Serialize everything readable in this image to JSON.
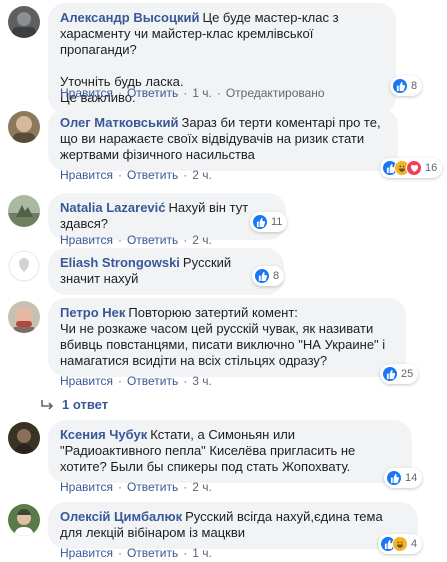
{
  "action_labels": {
    "like": "Нравится",
    "reply": "Ответить",
    "edited": "Отредактировано"
  },
  "comments": [
    {
      "author": "Александр Высоцкий",
      "text": "Це буде мастер-клас з харасменту чи майстер-клас кремлівської пропаганди?\n\nУточніть будь ласка.\nЦе важливо.",
      "time": "1 ч.",
      "reaction_count": "8",
      "edited": true
    },
    {
      "author": "Олег Матковський",
      "text": "Зараз би терти коментарі про те, що ви наражаєте своїх відвідувачів на ризик стати жертвами фізичного насильства",
      "time": "2 ч.",
      "reaction_count": "16"
    },
    {
      "author": "Natalia Lazarević",
      "text": "Нахуй він тут здався?",
      "time": "2 ч.",
      "reaction_count": "11"
    },
    {
      "author": "Eliash Strongowski",
      "text": "Русский значит нахуй",
      "time": "2 ч.",
      "reaction_count": "8"
    },
    {
      "author": "Петро Нек",
      "text": "Повторюю затертий комент:\nЧи не розкаже часом цей русскій чувак, як називати вбивць повстанцями, писати виключно \"НА Украине\" і намагатися всидіти на всіх стільцях одразу?",
      "time": "3 ч.",
      "reaction_count": "25"
    },
    {
      "author": "Ксения Чубук",
      "text": "Кстати, а Симоньян или \"Радиоактивного пепла\" Киселёва пригласить не хотите? Были бы спикеры под стать Жопохвату.",
      "time": "2 ч.",
      "reaction_count": "14"
    },
    {
      "author": "Олексій Цимбалюк",
      "text": "Русский всігда нахуй,єдина тема для лекцій вібінаром із мацкви",
      "time": "1 ч.",
      "reaction_count": "4"
    }
  ],
  "replies_link": "1 ответ",
  "colors": {
    "link": "#385898",
    "bubble": "#f2f3f5",
    "meta": "#606770",
    "like": "#1877f2",
    "love": "#f33e58",
    "haha": "#f7b125"
  }
}
